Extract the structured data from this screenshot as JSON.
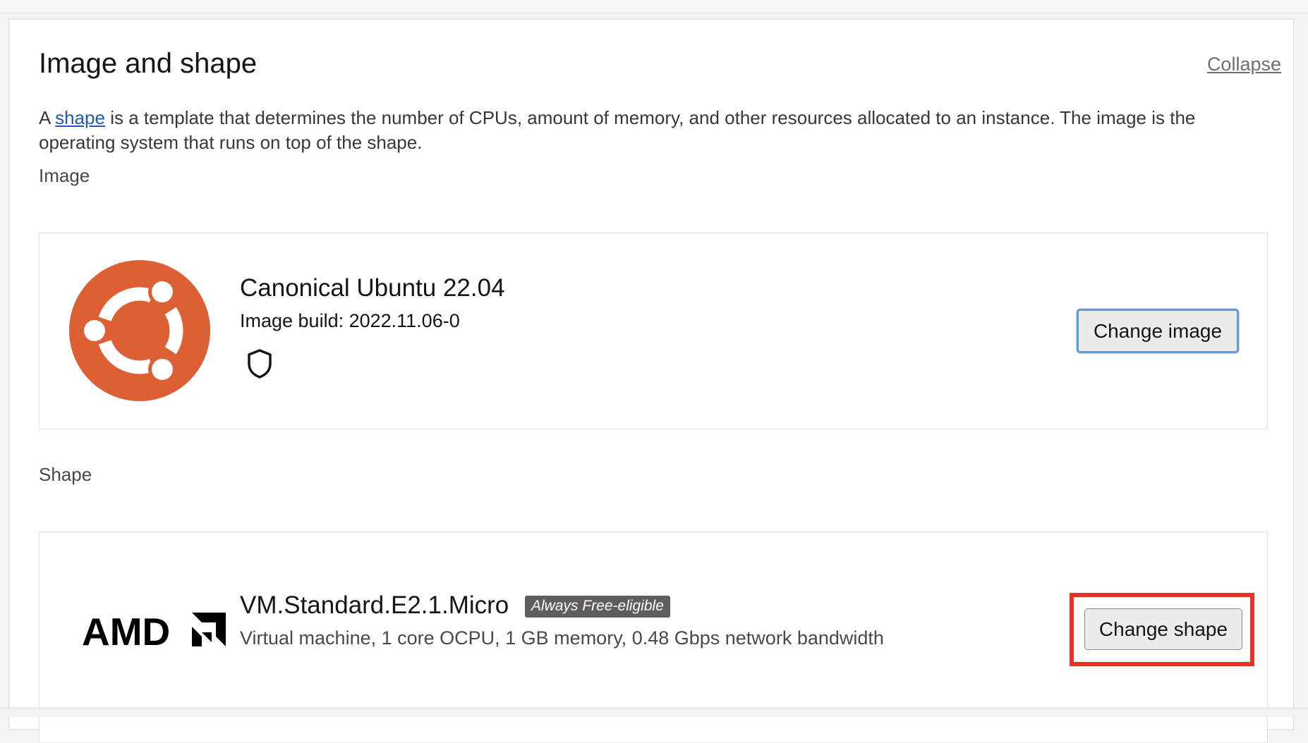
{
  "section": {
    "title": "Image and shape",
    "collapse_label": "Collapse",
    "description_prefix": "A ",
    "description_link": "shape",
    "description_suffix": " is a template that determines the number of CPUs, amount of memory, and other resources allocated to an instance. The image is the operating system that runs on top of the shape."
  },
  "image": {
    "heading": "Image",
    "name": "Canonical Ubuntu 22.04",
    "build": "Image build: 2022.11.06-0",
    "logo_icon": "ubuntu-logo-icon",
    "badge_icon": "shield-icon",
    "change_button": "Change image",
    "logo_color": "#dd5f34"
  },
  "shape": {
    "heading": "Shape",
    "logo_text": "AMD",
    "logo_icon": "amd-logo-icon",
    "name": "VM.Standard.E2.1.Micro",
    "badge": "Always Free-eligible",
    "details": "Virtual machine, 1 core OCPU, 1 GB memory, 0.48 Gbps network bandwidth",
    "change_button": "Change shape",
    "highlight_color": "#e63324"
  }
}
